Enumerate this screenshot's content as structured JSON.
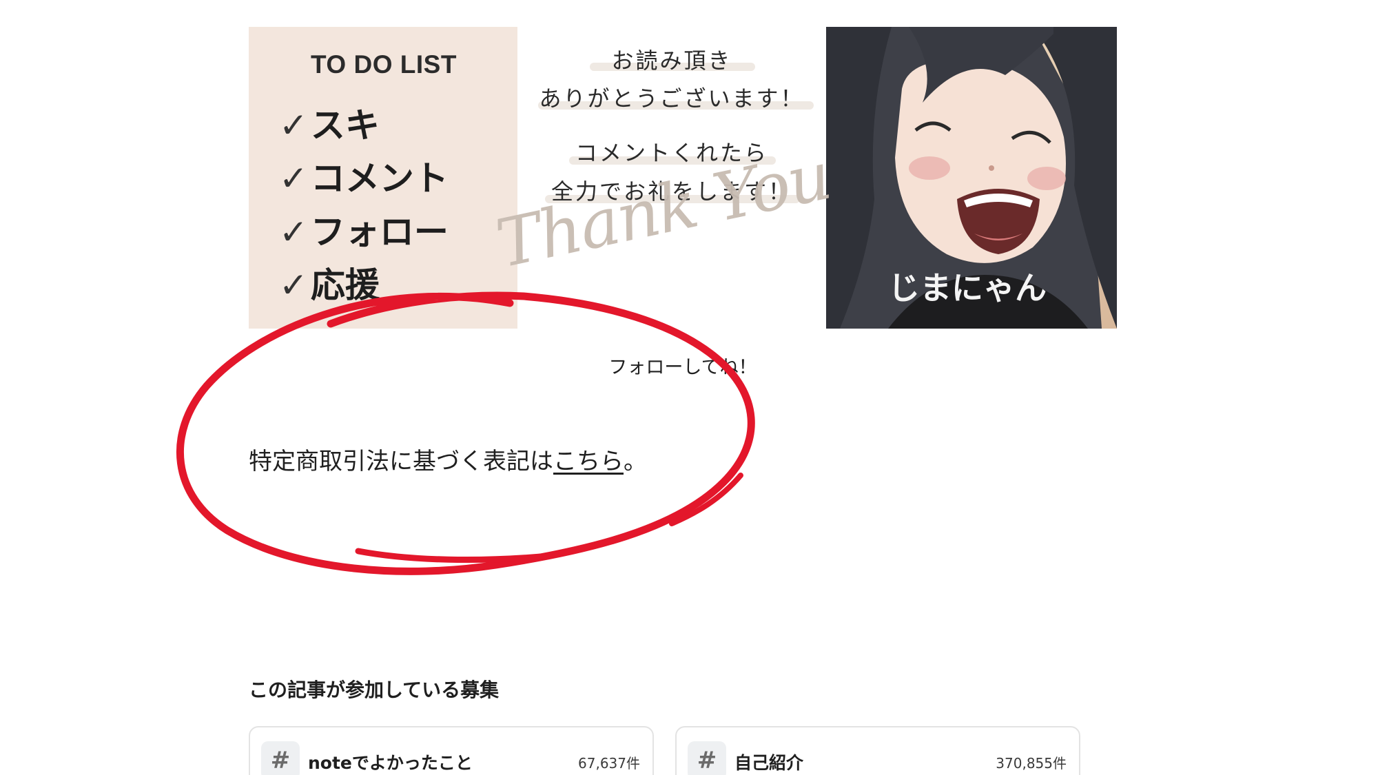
{
  "banner": {
    "todo_title": "TO DO LIST",
    "todo_items": [
      "スキ",
      "コメント",
      "フォロー",
      "応援"
    ],
    "check_mark": "✓",
    "message_lines": [
      "お読み頂き",
      "ありがとうございます！",
      "コメントくれたら",
      "全力でお礼をします！"
    ],
    "script_text": "Thank You",
    "character_name": "じまにゃん",
    "colors": {
      "left_panel": "#f3e6dd",
      "script": "#c8bcb2"
    }
  },
  "caption": "フォローしてね！",
  "legal": {
    "prefix": "特定商取引法に基づく表記は",
    "link_text": "こちら",
    "suffix": "。"
  },
  "annotation": {
    "color": "#e3172b"
  },
  "contests": {
    "heading": "この記事が参加している募集",
    "items": [
      {
        "icon": "#",
        "name": "noteでよかったこと",
        "count": "67,637件"
      },
      {
        "icon": "#",
        "name": "自己紹介",
        "count": "370,855件"
      }
    ]
  }
}
